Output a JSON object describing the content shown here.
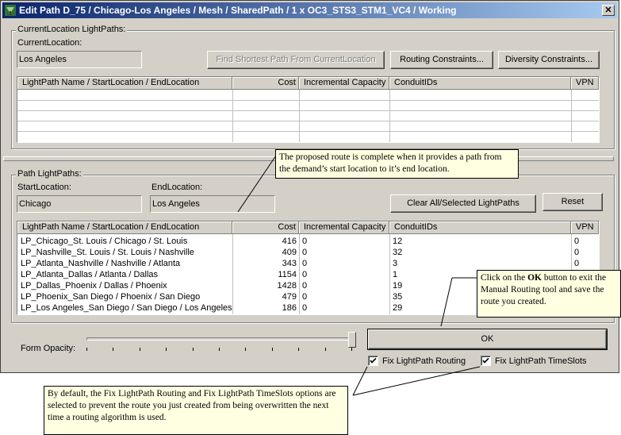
{
  "window": {
    "title": "Edit Path D_75 / Chicago-Los Angeles / Mesh / SharedPath / 1 x OC3_STS3_STM1_VC4 / Working",
    "close_glyph": "✕"
  },
  "current_group": {
    "legend": "CurrentLocation LightPaths:",
    "current_location_label": "CurrentLocation:",
    "current_location_value": "Los Angeles",
    "find_shortest_button": "Find Shortest Path From CurrentLocation",
    "routing_constraints_button": "Routing Constraints...",
    "diversity_constraints_button": "Diversity Constraints...",
    "columns": [
      "LightPath Name / StartLocation / EndLocation",
      "Cost",
      "Incremental Capacity",
      "ConduitIDs",
      "VPN"
    ],
    "rows": []
  },
  "path_group": {
    "legend": "Path LightPaths:",
    "start_location_label": "StartLocation:",
    "start_location_value": "Chicago",
    "end_location_label": "EndLocation:",
    "end_location_value": "Los Angeles",
    "clear_button": "Clear All/Selected LightPaths",
    "reset_button": "Reset",
    "columns": [
      "LightPath Name / StartLocation / EndLocation",
      "Cost",
      "Incremental Capacity",
      "ConduitIDs",
      "VPN"
    ],
    "rows": [
      {
        "name": "LP_Chicago_St. Louis / Chicago / St. Louis",
        "cost": "416",
        "capacity": "0",
        "conduits": "12",
        "vpn": "0"
      },
      {
        "name": "LP_Nashville_St. Louis / St. Louis / Nashville",
        "cost": "409",
        "capacity": "0",
        "conduits": "32",
        "vpn": "0"
      },
      {
        "name": "LP_Atlanta_Nashville / Nashville / Atlanta",
        "cost": "343",
        "capacity": "0",
        "conduits": "3",
        "vpn": "0"
      },
      {
        "name": "LP_Atlanta_Dallas / Atlanta / Dallas",
        "cost": "1154",
        "capacity": "0",
        "conduits": "1",
        "vpn": ""
      },
      {
        "name": "LP_Dallas_Phoenix / Dallas / Phoenix",
        "cost": "1428",
        "capacity": "0",
        "conduits": "19",
        "vpn": ""
      },
      {
        "name": "LP_Phoenix_San Diego / Phoenix / San Diego",
        "cost": "479",
        "capacity": "0",
        "conduits": "35",
        "vpn": ""
      },
      {
        "name": "LP_Los Angeles_San Diego / San Diego / Los Angeles",
        "cost": "186",
        "capacity": "0",
        "conduits": "29",
        "vpn": ""
      }
    ]
  },
  "bottom": {
    "form_opacity_label": "Form Opacity:",
    "opacity_level": 1.0,
    "ok_button": "OK",
    "fix_routing_label": "Fix LightPath Routing",
    "fix_routing_checked": true,
    "fix_timeslots_label": "Fix LightPath TimeSlots",
    "fix_timeslots_checked": true
  },
  "callouts": {
    "route_complete": "The proposed route is complete when it provides a path from the demand’s start location to it’s end location.",
    "ok_prefix": "Click on the ",
    "ok_bold": "OK",
    "ok_suffix": " button to exit the Manual Routing tool and save the route you created.",
    "fix_default": "By default, the Fix LightPath Routing and Fix LightPath TimeSlots options are selected to prevent the route you just created from being overwritten the next time a routing algorithm is used."
  },
  "colors": {
    "titlebar_start": "#0a246a",
    "titlebar_end": "#a6caf0",
    "dialog_face": "#d4d0c8",
    "callout_bg": "#ffffe1"
  }
}
